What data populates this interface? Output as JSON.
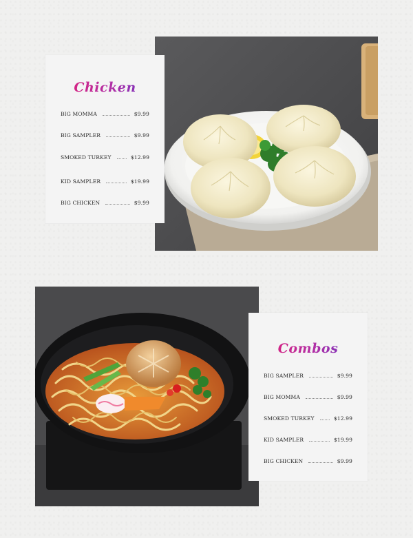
{
  "sections": [
    {
      "title": "Chicken",
      "items": [
        {
          "name": "BIG MOMMA",
          "price": "$9.99"
        },
        {
          "name": "BIG SAMPLER",
          "price": "$9.99"
        },
        {
          "name": "SMOKED TURKEY",
          "price": "$12.99"
        },
        {
          "name": "KID SAMPLER",
          "price": "$19.99"
        },
        {
          "name": "BIG CHICKEN",
          "price": "$9.99"
        }
      ]
    },
    {
      "title": "Combos",
      "items": [
        {
          "name": "BIG SAMPLER",
          "price": "$9.99"
        },
        {
          "name": "BIG MOMMA",
          "price": "$9.99"
        },
        {
          "name": "SMOKED TURKEY",
          "price": "$12.99"
        },
        {
          "name": "KID SAMPLER",
          "price": "$19.99"
        },
        {
          "name": "BIG CHICKEN",
          "price": "$9.99"
        }
      ]
    }
  ],
  "colors": {
    "title_gradient": [
      "#ec1b6c",
      "#b12fa6",
      "#5b34c8"
    ],
    "card_bg": "#f4f4f4",
    "page_bg": "#f0f0ef"
  }
}
